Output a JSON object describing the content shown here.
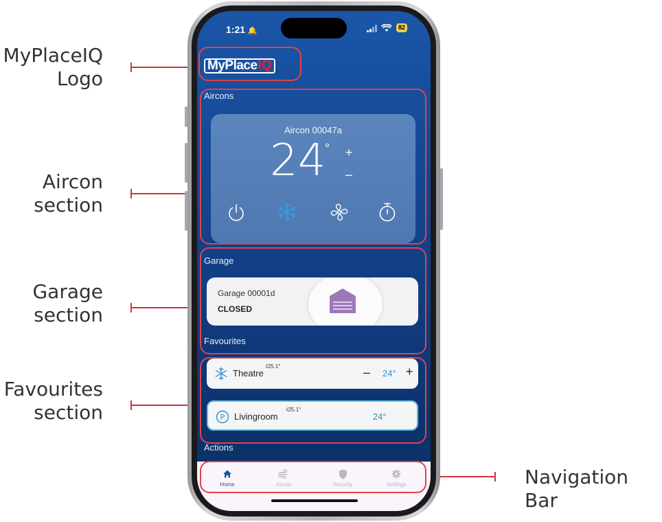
{
  "callouts": {
    "logo": {
      "line1": "MyPlaceIQ",
      "line2": "Logo"
    },
    "aircon": {
      "line1": "Aircon",
      "line2": "section"
    },
    "garage": {
      "line1": "Garage",
      "line2": "section"
    },
    "favourites": {
      "line1": "Favourites",
      "line2": "section"
    },
    "navigation": {
      "line1": "Navigation Bar"
    }
  },
  "status_bar": {
    "time": "1:21",
    "battery": "82"
  },
  "logo": {
    "brand": "MyPlace",
    "suffix": "IQ"
  },
  "aircons": {
    "section_title": "Aircons",
    "unit_name": "Aircon 00047a",
    "set_temp": "24",
    "degree": "°",
    "plus": "+",
    "minus": "–",
    "controls": [
      "power-icon",
      "snowflake-icon",
      "fan-icon",
      "timer-icon"
    ]
  },
  "garage": {
    "section_title": "Garage",
    "name": "Garage 00001d",
    "state": "CLOSED"
  },
  "favourites": {
    "section_title": "Favourites",
    "items": [
      {
        "name": "Theatre",
        "current_temp": "25.1°",
        "minus": "–",
        "set_temp": "24°",
        "plus": "+",
        "icon": "snowflake-icon"
      },
      {
        "name": "Livingroom",
        "current_temp": "25.1°",
        "set_temp": "24°",
        "icon": "p-circle-icon"
      }
    ]
  },
  "actions": {
    "section_title": "Actions"
  },
  "nav": {
    "items": [
      {
        "label": "Home",
        "icon": "home-icon",
        "active": true
      },
      {
        "label": "Aircon",
        "icon": "wind-icon",
        "active": false
      },
      {
        "label": "Security",
        "icon": "shield-icon",
        "active": false
      },
      {
        "label": "Settings",
        "icon": "gear-icon",
        "active": false
      }
    ]
  },
  "colors": {
    "screen_blue": "#1b56a8",
    "highlight_red": "#e0434b",
    "accent_blue": "#2b8fd1",
    "garage_purple": "#9b79b9"
  }
}
